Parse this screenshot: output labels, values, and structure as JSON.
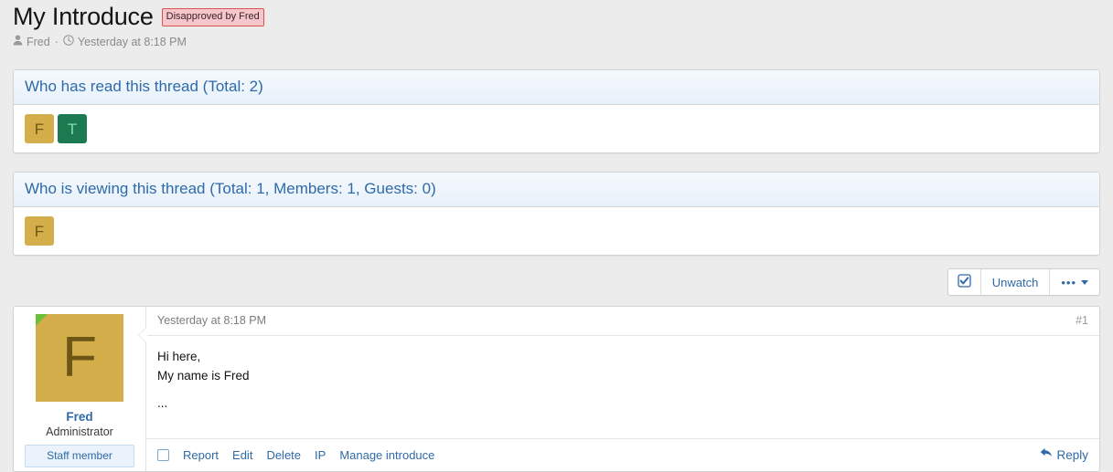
{
  "thread": {
    "title": "My Introduce",
    "status_badge": "Disapproved by Fred",
    "author": "Fred",
    "separator": "·",
    "timestamp": "Yesterday at 8:18 PM",
    "user_icon": "user-icon",
    "clock_icon": "clock-icon"
  },
  "read_block": {
    "header": "Who has read this thread (Total: 2)",
    "avatars": [
      {
        "letter": "F",
        "bg": "#d4ae4b",
        "fg": "#6b5616"
      },
      {
        "letter": "T",
        "bg": "#1b7a4f",
        "fg": "#7ee0b0"
      }
    ]
  },
  "viewing_block": {
    "header": "Who is viewing this thread (Total: 1, Members: 1, Guests: 0)",
    "avatars": [
      {
        "letter": "F",
        "bg": "#d4ae4b",
        "fg": "#6b5616"
      }
    ]
  },
  "toolbar": {
    "watch_icon": "checked-box-icon",
    "unwatch_label": "Unwatch",
    "more_dots": "•••",
    "more_icon": "chevron-down-icon"
  },
  "post": {
    "timestamp": "Yesterday at 8:18 PM",
    "number": "#1",
    "avatar": {
      "letter": "F",
      "bg": "#d4ae4b",
      "fg": "#6b5616"
    },
    "online_icon": "online-indicator-icon",
    "username": "Fred",
    "user_title": "Administrator",
    "staff_banner": "Staff member",
    "body_lines": [
      "Hi here,",
      "My name is Fred",
      "..."
    ],
    "footer_links": [
      "Report",
      "Edit",
      "Delete",
      "IP",
      "Manage introduce"
    ],
    "reply_label": "Reply",
    "reply_icon": "reply-arrow-icon"
  },
  "colors": {
    "accent": "#2f6aa8",
    "page_bg": "#ececec",
    "badge_bg": "#f5c6cb",
    "badge_border": "#d9534f",
    "online": "#6bbf3a"
  }
}
